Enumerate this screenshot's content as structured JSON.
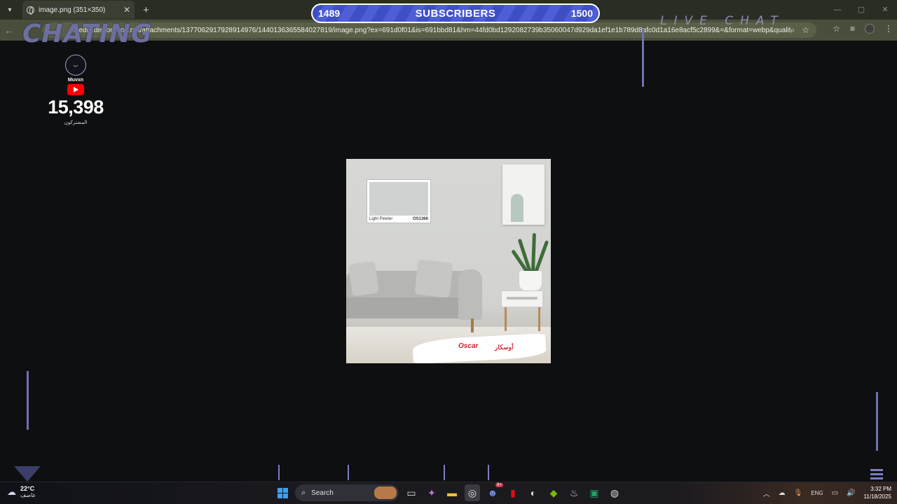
{
  "browser": {
    "tab_title": "image.png (351×350)",
    "url": "media.discordapp.net/attachments/1377062917928914976/1440136365584027819/image.png?ex=691d0f01&is=691bbd81&hm=44fd0bd1292082739b35060047d929da1ef1e1b789d8afc0d1a16e8acf5c2899&=&format=webp&quality=lossless..."
  },
  "overlay": {
    "chating": "CHATING",
    "live_chat": "LIVE CHAT",
    "sub_goal": {
      "current": "1489",
      "label": "SUBSCRIBERS",
      "target": "1500",
      "progress": 0.99
    },
    "channel": {
      "name": "Muvxn",
      "subscriber_count": "15,398",
      "subscriber_label": "المشتركون"
    }
  },
  "image": {
    "swatch_name": "Light Pewter",
    "swatch_code": "OS1366",
    "brand": "Oscar",
    "brand_arabic": "أوسكار"
  },
  "taskbar": {
    "weather_temp": "22°C",
    "weather_condition": "عاصف",
    "search_placeholder": "Search",
    "language": "ENG",
    "time": "3:32 PM",
    "date": "11/18/2025",
    "discord_badge": "9+"
  },
  "icons": [
    "globe-icon",
    "close-icon",
    "plus-icon",
    "back-icon",
    "forward-icon",
    "reload-icon",
    "zoom-icon",
    "star-icon",
    "youtube-icon",
    "windows-icon",
    "search-icon",
    "chrome-icon",
    "discord-icon",
    "steam-icon",
    "wifi-icon",
    "volume-icon"
  ],
  "colors": {
    "sub_bar": "#3f4ec4",
    "overlay_accent": "#6d6f9f",
    "youtube": "#ff0000",
    "address_bar": "#4a4f3d"
  }
}
